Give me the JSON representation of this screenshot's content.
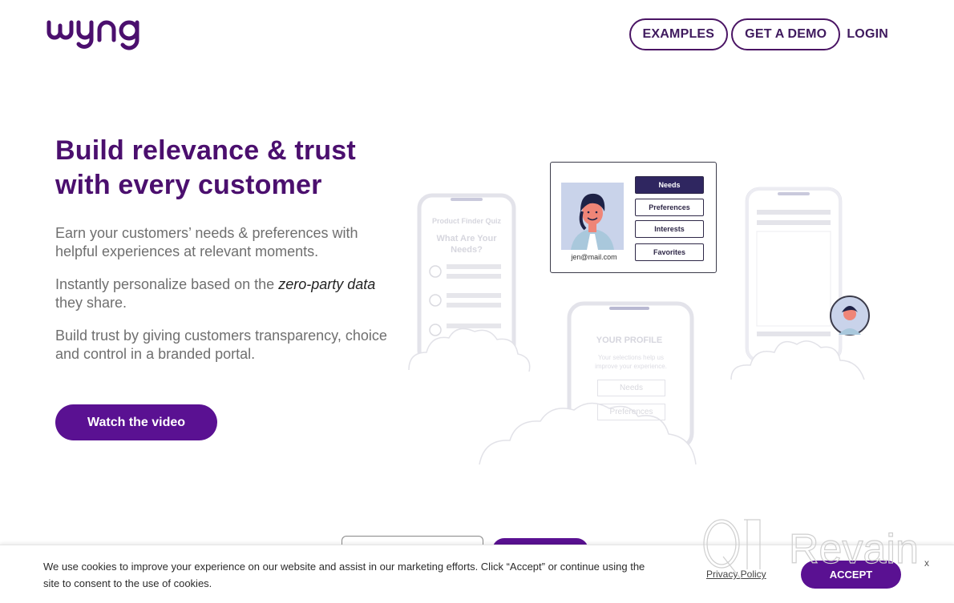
{
  "brand": {
    "name": "wyng",
    "color": "#4b0f6e",
    "accent": "#5a1192"
  },
  "nav": {
    "examples": "EXAMPLES",
    "get_demo": "GET A DEMO",
    "login": "LOGIN"
  },
  "hero": {
    "headline": "Build relevance & trust with every customer",
    "p1": "Earn your customers’ needs & preferences with helpful experiences at relevant moments.",
    "p2_before": "Instantly personalize based on the ",
    "p2_em": "zero-party data",
    "p2_after": " they share.",
    "p3": "Build trust by giving customers transparency, choice and control in a branded portal.",
    "cta": "Watch the video"
  },
  "illustration": {
    "profile_card": {
      "email": "jen@mail.com",
      "tags": [
        {
          "label": "Needs",
          "active": true
        },
        {
          "label": "Preferences",
          "active": false
        },
        {
          "label": "Interests",
          "active": false
        },
        {
          "label": "Favorites",
          "active": false
        }
      ]
    },
    "quiz_phone": {
      "title": "Product Finder Quiz",
      "question": "What Are Your Needs?"
    },
    "profile_phone": {
      "title": "YOUR PROFILE",
      "subtitle": "Your selections help us improve your experience.",
      "buttons": [
        "Needs",
        "Preferences"
      ]
    }
  },
  "cookie": {
    "text": "We use cookies to improve your experience on our website and assist in our marketing efforts. Click “Accept” or continue using the site to consent to the use of cookies.",
    "privacy": "Privacy Policy",
    "accept": "ACCEPT",
    "close": "x"
  },
  "watermark": {
    "text": "Revain"
  }
}
